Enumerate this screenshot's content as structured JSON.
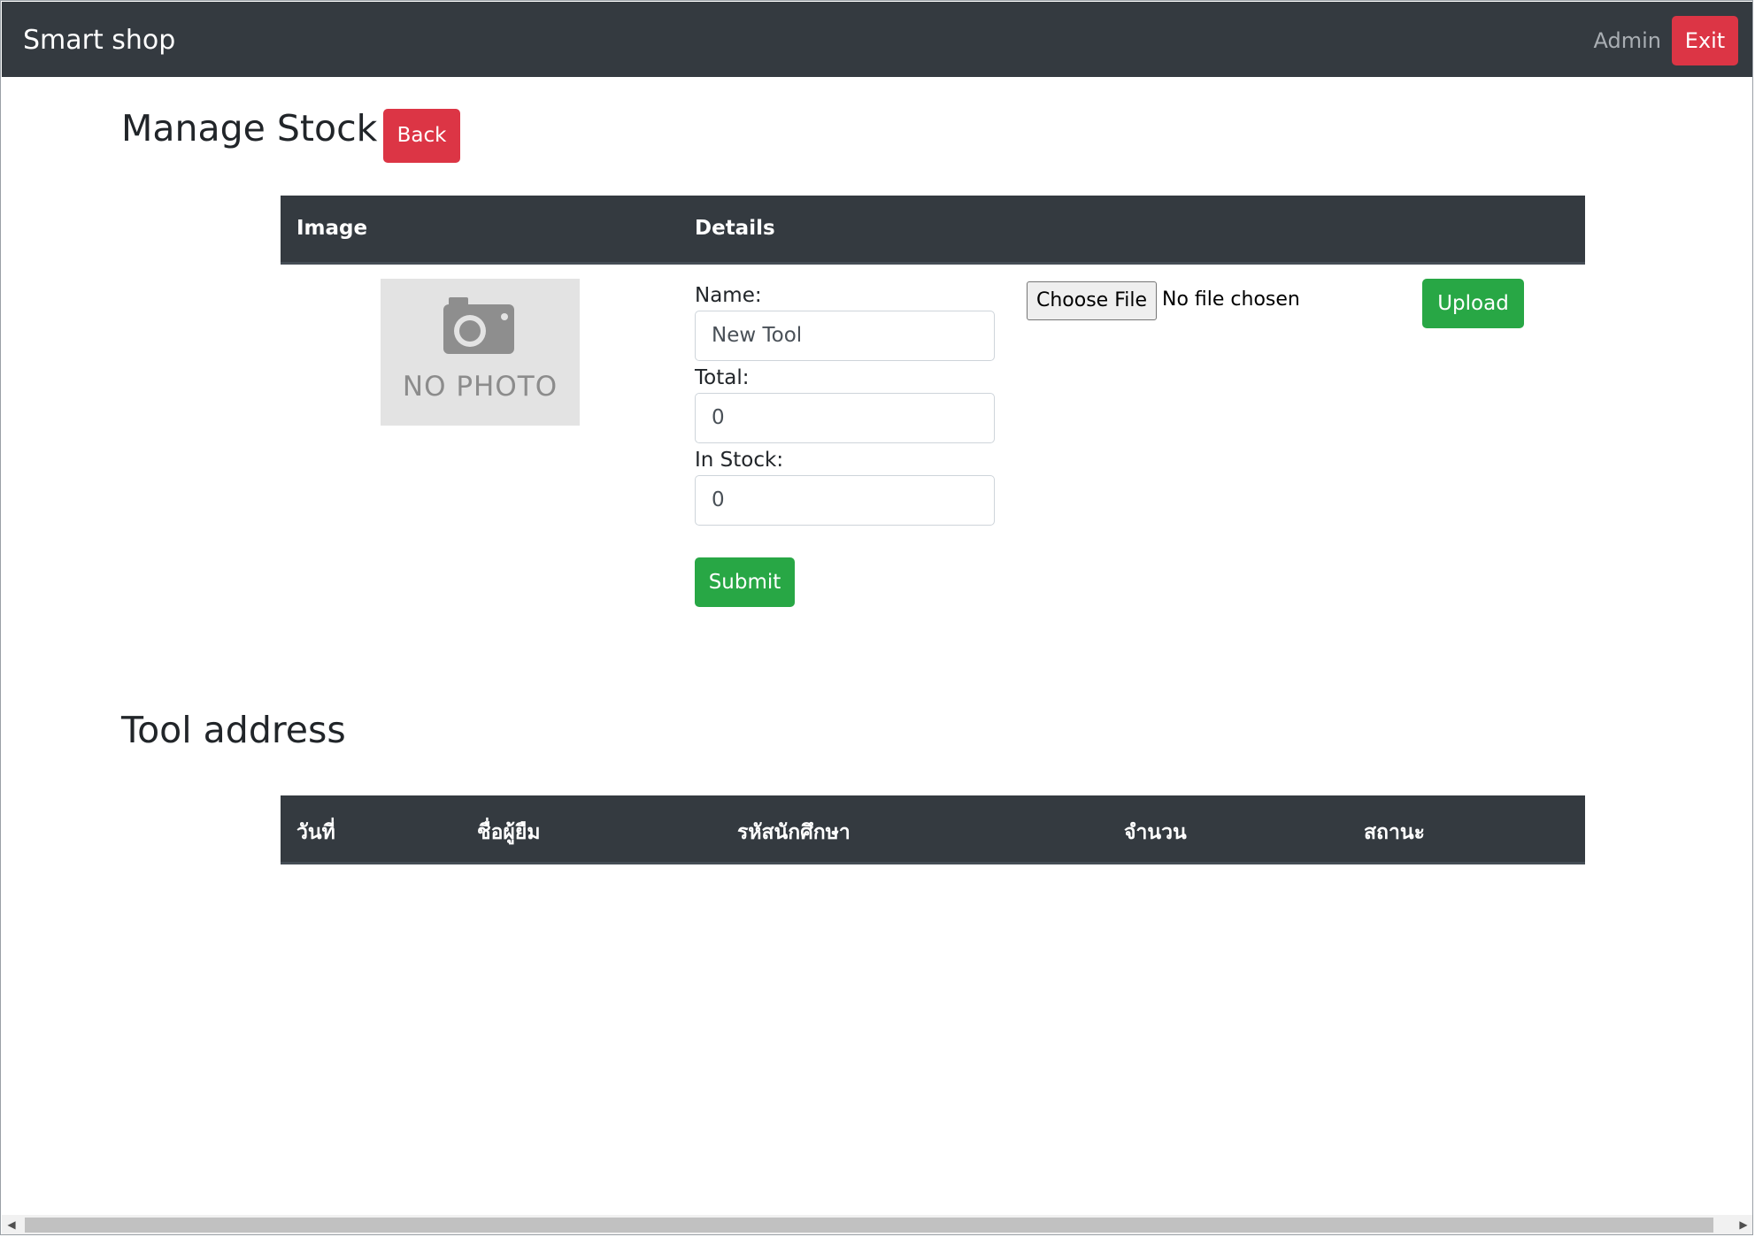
{
  "navbar": {
    "brand": "Smart shop",
    "user": "Admin",
    "exit_label": "Exit"
  },
  "manage": {
    "title": "Manage Stock",
    "back_label": "Back"
  },
  "stock_table": {
    "headers": [
      "Image",
      "Details"
    ],
    "image": {
      "placeholder_text": "NO PHOTO",
      "icon": "camera-icon"
    },
    "form": {
      "name_label": "Name:",
      "name_value": "New Tool",
      "total_label": "Total:",
      "total_value": "0",
      "instock_label": "In Stock:",
      "instock_value": "0",
      "submit_label": "Submit"
    },
    "file": {
      "choose_label": "Choose File",
      "status": "No file chosen",
      "upload_label": "Upload"
    }
  },
  "tool_address": {
    "title": "Tool address",
    "headers": [
      "วันที่",
      "ชื่อผู้ยืม",
      "รหัสนักศึกษา",
      "จำนวน",
      "สถานะ"
    ],
    "rows": []
  },
  "colors": {
    "navbar": "#343a40",
    "danger": "#dc3545",
    "success": "#28a745"
  }
}
